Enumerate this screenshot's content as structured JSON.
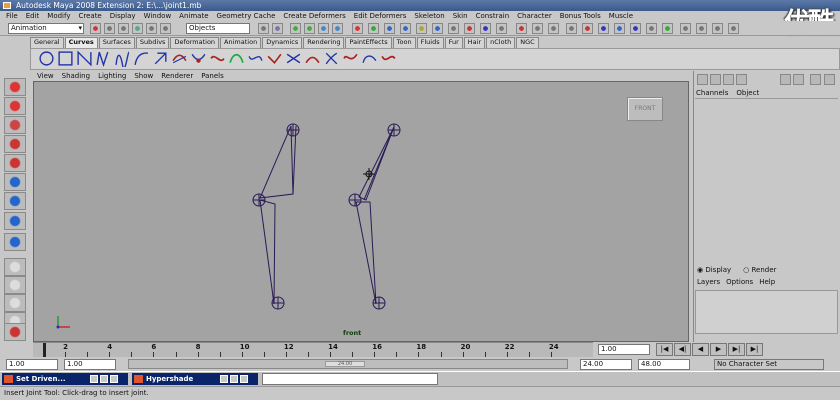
{
  "window": {
    "title": "Autodesk Maya 2008 Extension 2: E:\\...\\joint1.mb"
  },
  "watermark": {
    "text": "优酷"
  },
  "menubar": [
    "File",
    "Edit",
    "Modify",
    "Create",
    "Display",
    "Window",
    "Animate",
    "Geometry Cache",
    "Create Deformers",
    "Edit Deformers",
    "Skeleton",
    "Skin",
    "Constrain",
    "Character",
    "Bonus Tools",
    "Muscle"
  ],
  "statusline": {
    "mode": "Animation",
    "selection": "Objects"
  },
  "shelf": {
    "tabs": [
      "General",
      "Curves",
      "Surfaces",
      "Subdivs",
      "Deformation",
      "Animation",
      "Dynamics",
      "Rendering",
      "PaintEffects",
      "Toon",
      "Fluids",
      "Fur",
      "Hair",
      "nCloth",
      "NGC"
    ],
    "active_tab": "Curves"
  },
  "panel_menu": [
    "View",
    "Shading",
    "Lighting",
    "Show",
    "Renderer",
    "Panels"
  ],
  "viewport": {
    "camera_button": "FRONT",
    "camera_label": "front"
  },
  "channel_box": {
    "menu": [
      "Channels",
      "Object"
    ]
  },
  "layer_editor": {
    "display_label": "Display",
    "render_label": "Render",
    "menu": [
      "Layers",
      "Options",
      "Help"
    ]
  },
  "timeline": {
    "ticks": [
      "2",
      "4",
      "6",
      "8",
      "10",
      "12",
      "14",
      "16",
      "18",
      "20",
      "22",
      "24"
    ],
    "current_frame": "1.00"
  },
  "playback": {
    "buttons": [
      "|◀",
      "◀|",
      "◀",
      "▶",
      "▶|",
      "▶|"
    ]
  },
  "range": {
    "start": "1.00",
    "start_inner": "1.00",
    "end_inner": "24.00",
    "end": "48.00",
    "slider_label": "24.00",
    "character_set": "No Character Set"
  },
  "taskbar": {
    "tasks": [
      "Set Driven...",
      "Hypershade"
    ]
  },
  "helpline": {
    "text": "Insert Joint Tool: Click-drag to insert joint."
  }
}
